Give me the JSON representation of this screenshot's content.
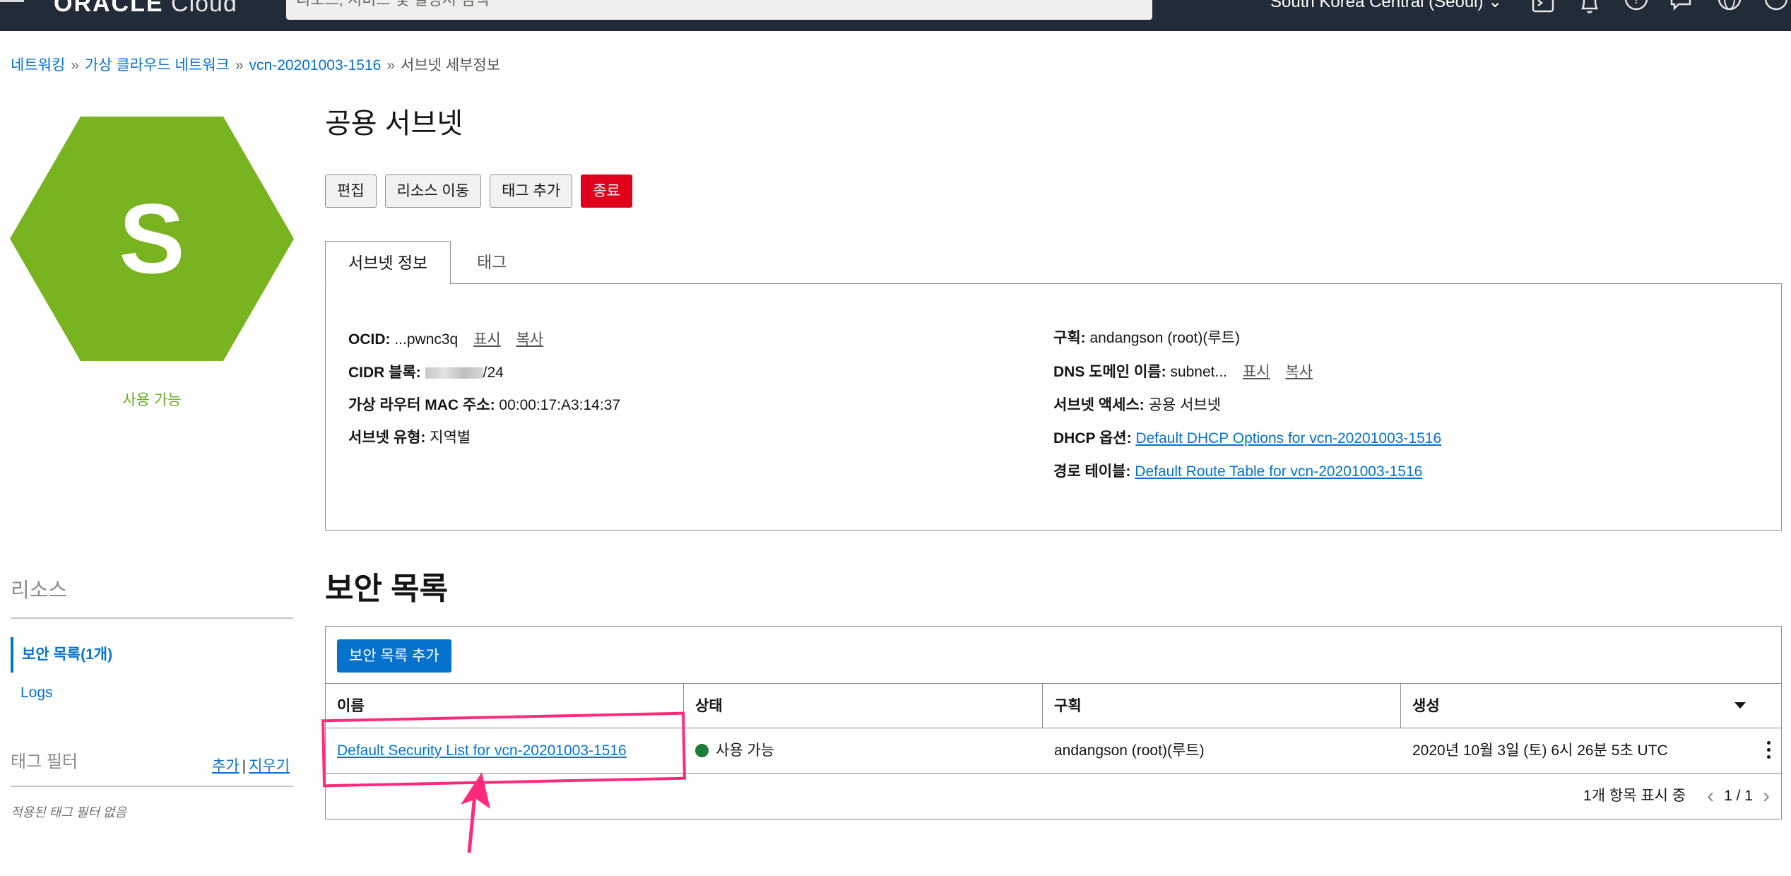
{
  "topbar": {
    "logo_brand": "ORACLE",
    "logo_product": "Cloud",
    "search_placeholder": "리소스, 서비스 및 설명서 검색",
    "region": "South Korea Central (Seoul)",
    "icons": [
      "cloud-shell-icon",
      "bell-icon",
      "help-icon",
      "chat-icon",
      "globe-icon",
      "user-icon"
    ]
  },
  "breadcrumb": {
    "items": [
      "네트워킹",
      "가상 클라우드 네트워크",
      "vcn-20201003-1516"
    ],
    "current": "서브넷 세부정보",
    "separator": "»"
  },
  "resource": {
    "letter": "S",
    "status": "사용 가능",
    "hex_color": "#77b41f"
  },
  "page": {
    "title": "공용 서브넷",
    "actions": {
      "edit": "편집",
      "move": "리소스 이동",
      "add_tag": "태그 추가",
      "terminate": "종료"
    }
  },
  "tabs": {
    "info": "서브넷 정보",
    "tags": "태그"
  },
  "info": {
    "ocid_label": "OCID:",
    "ocid_value": "...pwnc3q",
    "show": "표시",
    "copy": "복사",
    "cidr_label": "CIDR 블록:",
    "cidr_suffix": "/24",
    "mac_label": "가상 라우터 MAC 주소:",
    "mac_value": "00:00:17:A3:14:37",
    "type_label": "서브넷 유형:",
    "type_value": "지역별",
    "compartment_label": "구획:",
    "compartment_value": "andangson (root)(루트)",
    "dns_label": "DNS 도메인 이름:",
    "dns_value": "subnet...",
    "access_label": "서브넷 액세스:",
    "access_value": "공용 서브넷",
    "dhcp_label": "DHCP 옵션:",
    "dhcp_value": "Default DHCP Options for vcn-20201003-1516",
    "route_label": "경로 테이블:",
    "route_value": "Default Route Table for vcn-20201003-1516"
  },
  "sidebar": {
    "heading": "리소스",
    "items": [
      {
        "label": "보안 목록(1개)",
        "active": true
      },
      {
        "label": "Logs",
        "active": false
      }
    ],
    "tag_filter": {
      "label": "태그 필터",
      "add": "추가",
      "sep": "|",
      "clear": "지우기",
      "empty": "적용된 태그 필터 없음"
    }
  },
  "security_lists": {
    "title": "보안 목록",
    "add_button": "보안 목록 추가",
    "columns": [
      "이름",
      "상태",
      "구획",
      "생성"
    ],
    "rows": [
      {
        "name": "Default Security List for vcn-20201003-1516",
        "status": "사용 가능",
        "compartment": "andangson (root)(루트)",
        "created": "2020년 10월 3일 (토) 6시 26분 5초 UTC"
      }
    ],
    "footer": "1개 항목 표시 중",
    "page_indicator": "1 / 1"
  },
  "annotation": {
    "color": "#ff2b7a"
  }
}
